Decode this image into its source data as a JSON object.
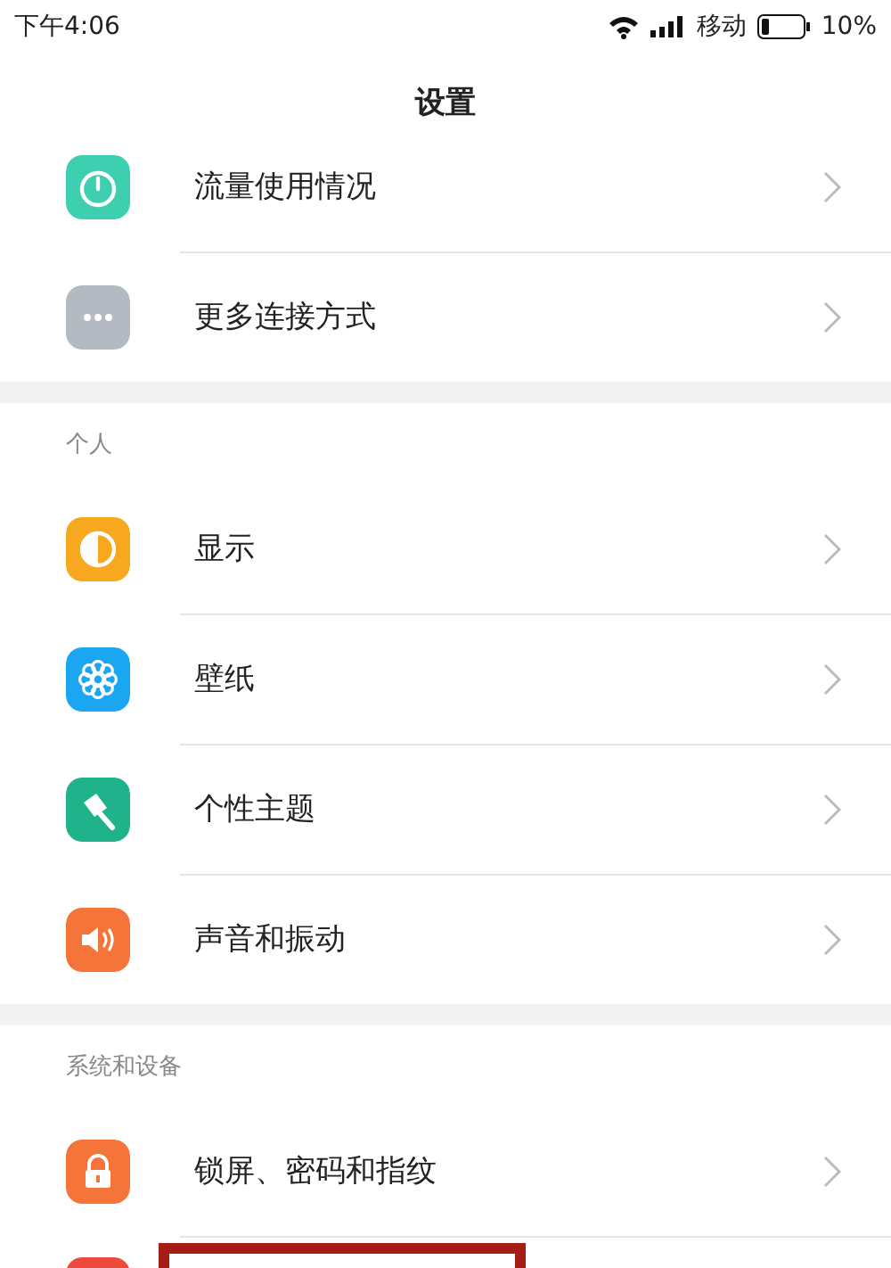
{
  "status_bar": {
    "time": "下午4:06",
    "carrier": "移动",
    "battery": "10%"
  },
  "title": "设置",
  "sections": [
    {
      "items": [
        {
          "label": "流量使用情况",
          "kind": "timer"
        },
        {
          "label": "更多连接方式",
          "kind": "more"
        }
      ]
    },
    {
      "header": "个人",
      "items": [
        {
          "label": "显示",
          "kind": "display"
        },
        {
          "label": "壁纸",
          "kind": "wallpaper"
        },
        {
          "label": "个性主题",
          "kind": "theme"
        },
        {
          "label": "声音和振动",
          "kind": "sound"
        }
      ]
    },
    {
      "header": "系统和设备",
      "items": [
        {
          "label": "锁屏、密码和指纹",
          "kind": "lock"
        },
        {
          "kind": "red",
          "annotation_box": true
        }
      ]
    }
  ]
}
